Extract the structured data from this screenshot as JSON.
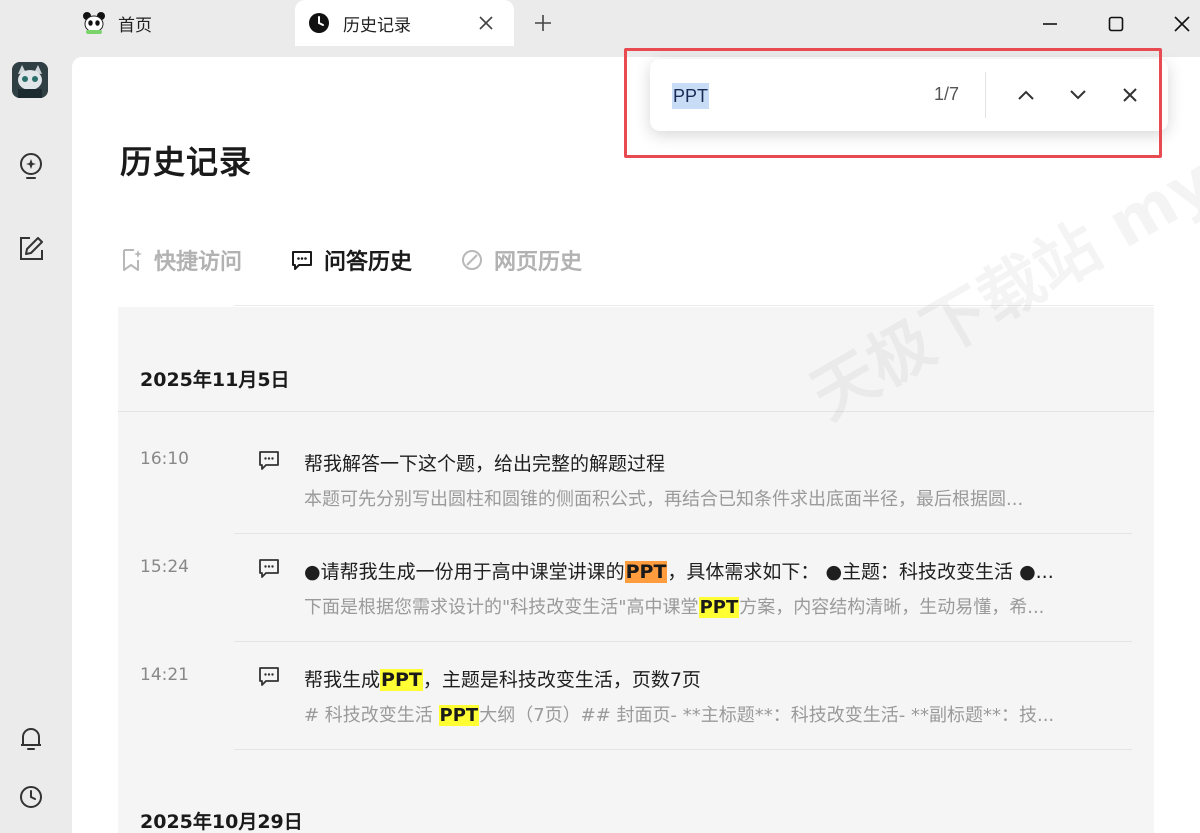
{
  "titlebar": {
    "tabs": [
      {
        "label": "首页",
        "icon": "panda-logo-icon"
      },
      {
        "label": "历史记录",
        "icon": "clock-icon"
      }
    ],
    "new_tab_icon": "plus-icon",
    "window_controls": [
      "minimize-icon",
      "maximize-icon",
      "close-icon"
    ]
  },
  "rail": {
    "items": [
      "avatar",
      "lightbulb-icon",
      "edit-icon",
      "bell-icon",
      "history-icon"
    ]
  },
  "page": {
    "title": "历史记录",
    "category_tabs": [
      {
        "label": "快捷访问",
        "icon": "star-bookmark-icon",
        "active": false
      },
      {
        "label": "问答历史",
        "icon": "chat-icon",
        "active": true
      },
      {
        "label": "网页历史",
        "icon": "compass-icon",
        "active": false
      }
    ]
  },
  "history": {
    "groups": [
      {
        "date": "2025年11月5日",
        "entries": [
          {
            "time": "16:10",
            "question": "帮我解答一下这个题，给出完整的解题过程",
            "answer": "本题可先分别写出圆柱和圆锥的侧面积公式，再结合已知条件求出底面半径，最后根据圆..."
          },
          {
            "time": "15:24",
            "question_parts": [
              "●请帮我生成一份用于高中课堂讲课的",
              "PPT",
              "，具体需求如下： ●主题：科技改变生活 ●..."
            ],
            "answer_parts": [
              "下面是根据您需求设计的\"科技改变生活\"高中课堂",
              "PPT",
              "方案，内容结构清晰，生动易懂，希..."
            ]
          },
          {
            "time": "14:21",
            "question_parts": [
              "帮我生成",
              "PPT",
              "，主题是科技改变生活，页数7页"
            ],
            "answer_parts": [
              "# 科技改变生活 ",
              "PPT",
              "大纲（7页）## 封面页- **主标题**：科技改变生活- **副标题**：技..."
            ]
          }
        ]
      },
      {
        "date": "2025年10月29日",
        "entries": []
      }
    ]
  },
  "find_bar": {
    "query": "PPT",
    "count": "1/7",
    "buttons": [
      "chevron-up-icon",
      "chevron-down-icon",
      "close-icon"
    ]
  },
  "watermark": "天极下载站 mydown.yesky.com",
  "colors": {
    "highlight_match": "#ffff33",
    "highlight_current": "#ff9c3d",
    "annotation_frame": "#e84a52"
  }
}
